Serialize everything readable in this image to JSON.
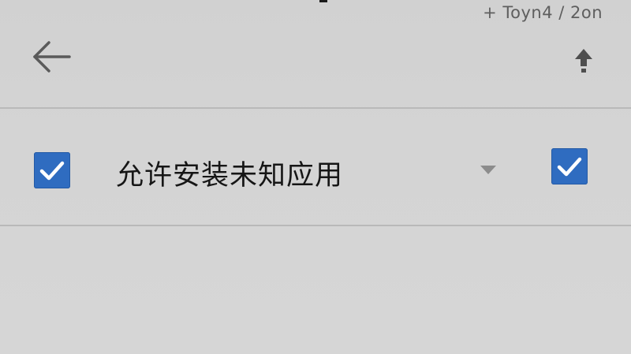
{
  "status_bar": {
    "text": "+ Toyn4 / 2on"
  },
  "header": {
    "back_icon": "arrow-left-icon",
    "action_icon": "upload-arrow-icon"
  },
  "setting": {
    "label": "允许安装未知应用",
    "left_checked": true,
    "right_checked": true,
    "dropdown_icon": "caret-down-icon"
  },
  "colors": {
    "background": "#d3d3d3",
    "checkbox_fill": "#2f6cc0",
    "checkmark": "#ffffff",
    "text": "#161616",
    "icon": "#555555",
    "divider": "#b9b9b9"
  }
}
